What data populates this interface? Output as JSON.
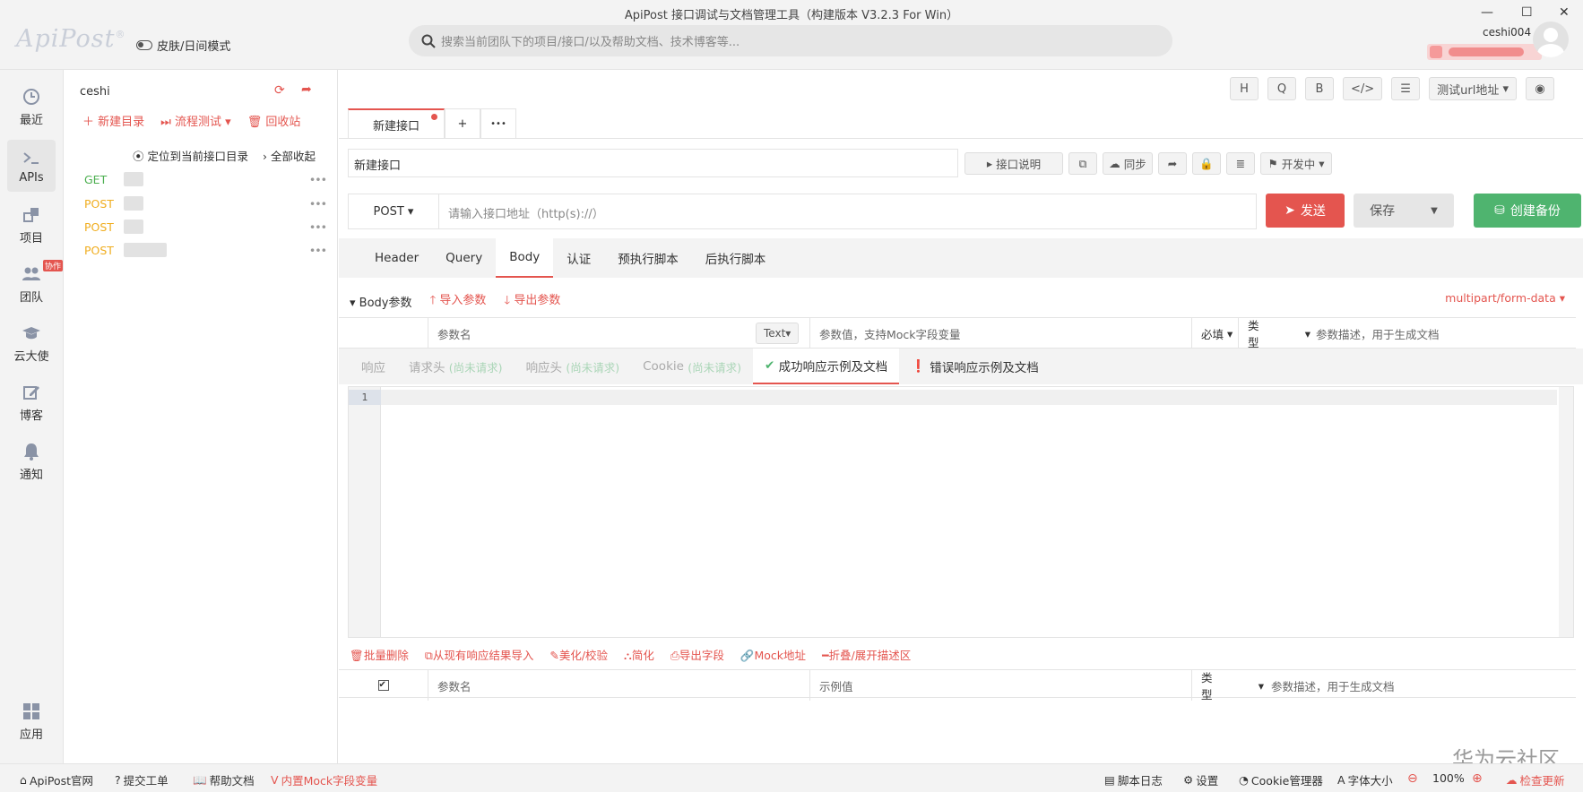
{
  "window": {
    "title": "ApiPost 接口调试与文档管理工具（构建版本 V3.2.3 For Win）",
    "minimize": "—",
    "maximize": "☐",
    "close": "✕"
  },
  "logo": {
    "text": "ApiPost",
    "reg": "®"
  },
  "skin_toggle": {
    "label": "皮肤/日间模式"
  },
  "search": {
    "placeholder": "搜索当前团队下的项目/接口/以及帮助文档、技术博客等..."
  },
  "user": {
    "name": "ceshi004"
  },
  "nav": [
    {
      "label": "最近",
      "icon": "clock-icon"
    },
    {
      "label": "APIs",
      "icon": "terminal-icon"
    },
    {
      "label": "项目",
      "icon": "project-icon"
    },
    {
      "label": "团队",
      "icon": "team-icon",
      "badge": "协作"
    },
    {
      "label": "云大使",
      "icon": "graduation-cap-icon"
    },
    {
      "label": "博客",
      "icon": "edit-icon"
    },
    {
      "label": "通知",
      "icon": "bell-icon"
    },
    {
      "label": "应用",
      "icon": "apps-icon"
    }
  ],
  "tree": {
    "project": "ceshi",
    "new_dir": "新建目录",
    "flow_test": "流程测试",
    "recycle": "回收站",
    "locate": "定位到当前接口目录",
    "collapse_all": "全部收起",
    "apis": [
      {
        "method": "GET",
        "color": "#4caf50"
      },
      {
        "method": "POST",
        "color": "#f0ad1f"
      },
      {
        "method": "POST",
        "color": "#f0ad1f"
      },
      {
        "method": "POST",
        "color": "#f0ad1f"
      }
    ]
  },
  "toolbar": {
    "h": "H",
    "q": "Q",
    "b": "B",
    "code": "</>",
    "adjust": "☰",
    "env": "测试url地址",
    "eye": "◉"
  },
  "tabs": {
    "active": "新建接口",
    "add": "+",
    "more": "•••"
  },
  "api": {
    "name": "新建接口",
    "desc_btn": "接口说明",
    "sync_btn": "同步",
    "status": "开发中",
    "method": "POST",
    "url_placeholder": "请输入接口地址（http(s)://）",
    "send": "发送",
    "save": "保存",
    "backup": "创建备份"
  },
  "subtabs": [
    "Header",
    "Query",
    "Body",
    "认证",
    "预执行脚本",
    "后执行脚本"
  ],
  "body": {
    "title": "Body参数",
    "import": "导入参数",
    "export": "导出参数",
    "content_type": "multipart/form-data",
    "param_name": "参数名",
    "type_btn": "Text",
    "param_value": "参数值，支持Mock字段变量",
    "required": "必填",
    "type_label": "类型",
    "param_desc": "参数描述，用于生成文档"
  },
  "resp_tabs": [
    {
      "label": "响应",
      "note": ""
    },
    {
      "label": "请求头",
      "note": "(尚未请求)"
    },
    {
      "label": "响应头",
      "note": "(尚未请求)"
    },
    {
      "label": "Cookie",
      "note": "(尚未请求)"
    },
    {
      "label": "成功响应示例及文档",
      "note": ""
    },
    {
      "label": "错误响应示例及文档",
      "note": ""
    }
  ],
  "editor": {
    "line": "1"
  },
  "resp_tools": [
    "批量删除",
    "从现有响应结果导入",
    "美化/校验",
    "简化",
    "导出字段",
    "Mock地址",
    "折叠/展开描述区"
  ],
  "resp_params": {
    "name": "参数名",
    "example": "示例值",
    "type": "类型",
    "desc": "参数描述，用于生成文档",
    "checkbox": "✔"
  },
  "statusbar": {
    "site": "ApiPost官网",
    "ticket": "提交工单",
    "help": "帮助文档",
    "mock": "内置Mock字段变量",
    "log": "脚本日志",
    "settings": "设置",
    "cookie": "Cookie管理器",
    "font": "字体大小",
    "zoom": "100%",
    "update": "检查更新"
  },
  "watermark": "华为云社区"
}
